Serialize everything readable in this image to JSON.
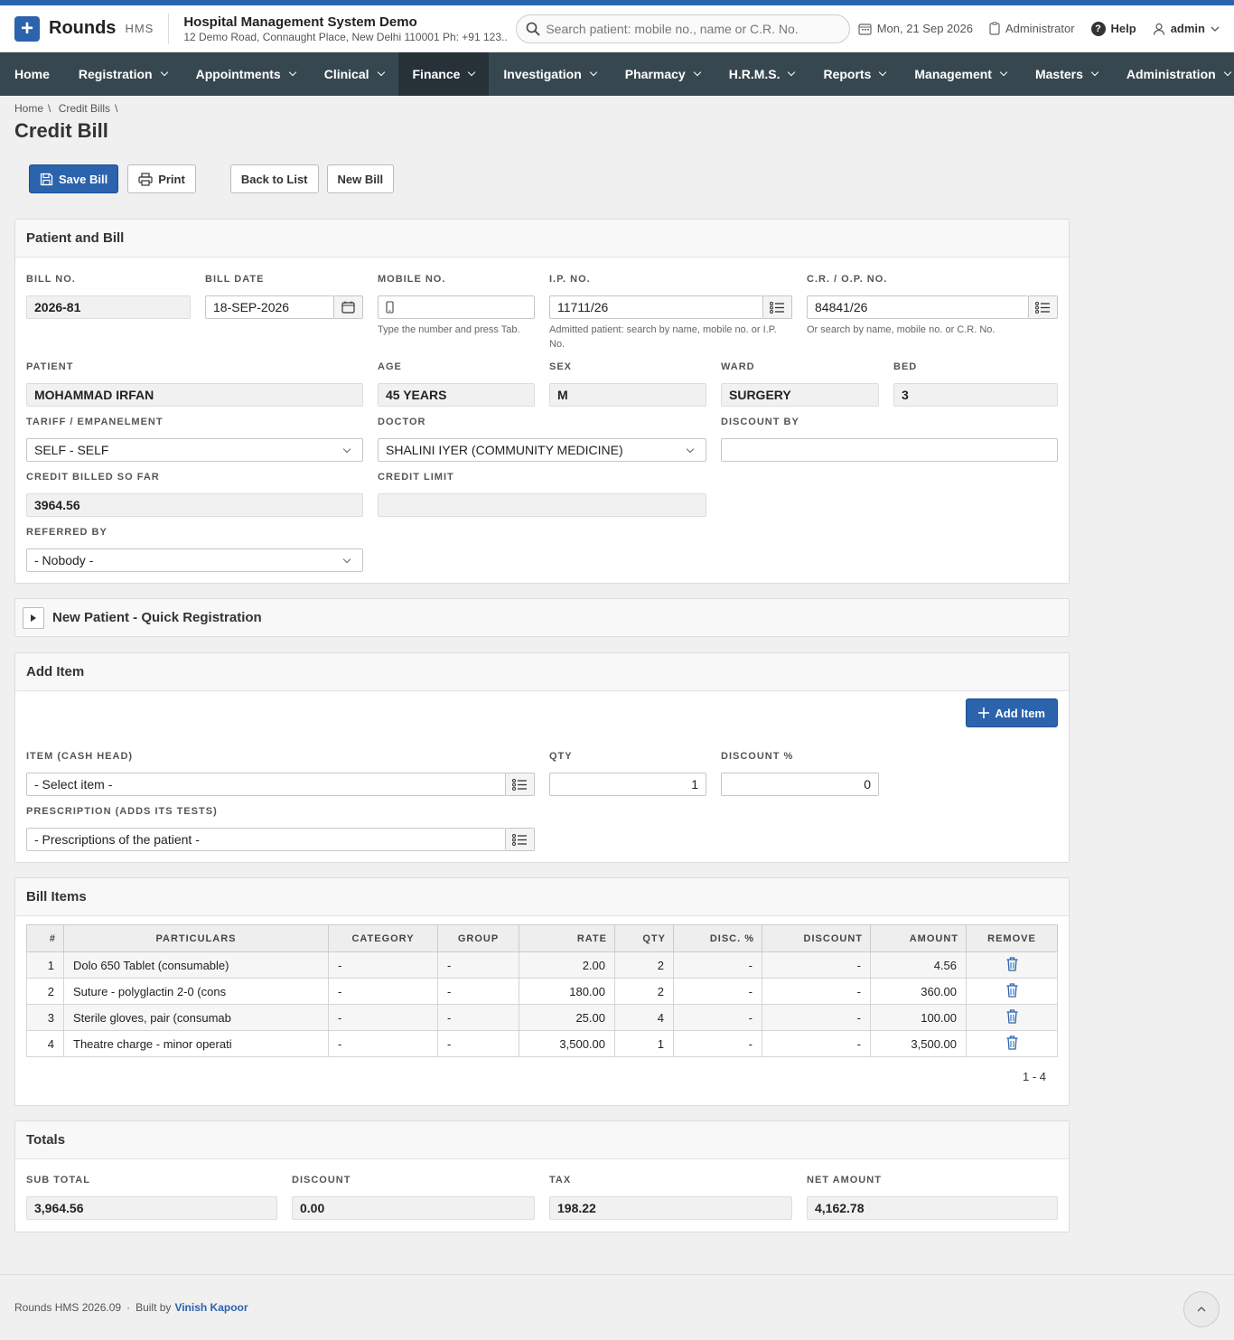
{
  "app": {
    "name": "Rounds",
    "suffix": "HMS",
    "logo_glyph": "+"
  },
  "hospital": {
    "name": "Hospital Management System Demo",
    "address": "12 Demo Road, Connaught Place, New Delhi 110001 Ph: +91 123..."
  },
  "search": {
    "placeholder": "Search patient: mobile no., name or C.R. No."
  },
  "header": {
    "date": "Mon, 21 Sep 2026",
    "role": "Administrator",
    "help": "Help",
    "user": "admin"
  },
  "nav": [
    {
      "label": "Home"
    },
    {
      "label": "Registration"
    },
    {
      "label": "Appointments"
    },
    {
      "label": "Clinical"
    },
    {
      "label": "Finance"
    },
    {
      "label": "Investigation"
    },
    {
      "label": "Pharmacy"
    },
    {
      "label": "H.R.M.S."
    },
    {
      "label": "Reports"
    },
    {
      "label": "Management"
    },
    {
      "label": "Masters"
    },
    {
      "label": "Administration"
    }
  ],
  "breadcrumb": [
    "Home",
    "Credit Bills"
  ],
  "page_title": "Credit Bill",
  "toolbar": {
    "save": "Save Bill",
    "print": "Print",
    "back": "Back to List",
    "new": "New Bill"
  },
  "patient_bill": {
    "heading": "Patient and Bill",
    "bill_no_label": "BILL NO.",
    "bill_no": "2026-81",
    "bill_date_label": "BILL DATE",
    "bill_date": "18-SEP-2026",
    "mobile_label": "MOBILE NO.",
    "mobile": "",
    "mobile_hint": "Type the number and press Tab.",
    "ip_label": "I.P. NO.",
    "ip": "11711/26",
    "ip_hint": "Admitted patient: search by name, mobile no. or I.P. No.",
    "cr_label": "C.R. / O.P. NO.",
    "cr": "84841/26",
    "cr_hint": "Or search by name, mobile no. or C.R. No.",
    "patient_label": "PATIENT",
    "patient": "MOHAMMAD IRFAN",
    "age_label": "AGE",
    "age": "45 YEARS",
    "sex_label": "SEX",
    "sex": "M",
    "ward_label": "WARD",
    "ward": "SURGERY",
    "bed_label": "BED",
    "bed": "3",
    "tariff_label": "TARIFF / EMPANELMENT",
    "tariff": "SELF - SELF",
    "doctor_label": "DOCTOR",
    "doctor": "SHALINI IYER (COMMUNITY MEDICINE)",
    "discount_by_label": "DISCOUNT BY",
    "discount_by": "",
    "credit_billed_label": "CREDIT BILLED SO FAR",
    "credit_billed": "3964.56",
    "credit_limit_label": "CREDIT LIMIT",
    "credit_limit": "",
    "referred_label": "REFERRED BY",
    "referred": "- Nobody -"
  },
  "quick_reg": {
    "heading": "New Patient - Quick Registration"
  },
  "add_item": {
    "heading": "Add Item",
    "add_button": "Add Item",
    "item_label": "ITEM (CASH HEAD)",
    "item": "- Select item -",
    "qty_label": "QTY",
    "qty": "1",
    "disc_label": "DISCOUNT %",
    "disc": "0",
    "rx_label": "PRESCRIPTION (ADDS ITS TESTS)",
    "rx": "- Prescriptions of the patient -"
  },
  "bill_items": {
    "heading": "Bill Items",
    "columns": [
      "#",
      "PARTICULARS",
      "CATEGORY",
      "GROUP",
      "RATE",
      "QTY",
      "DISC. %",
      "DISCOUNT",
      "AMOUNT",
      "REMOVE"
    ],
    "rows": [
      {
        "n": "1",
        "particulars": "Dolo 650 Tablet (consumable)",
        "category": "-",
        "group": "-",
        "rate": "2.00",
        "qty": "2",
        "disc_pct": "-",
        "discount": "-",
        "amount": "4.56"
      },
      {
        "n": "2",
        "particulars": "Suture - polyglactin 2-0 (cons",
        "category": "-",
        "group": "-",
        "rate": "180.00",
        "qty": "2",
        "disc_pct": "-",
        "discount": "-",
        "amount": "360.00"
      },
      {
        "n": "3",
        "particulars": "Sterile gloves, pair (consumab",
        "category": "-",
        "group": "-",
        "rate": "25.00",
        "qty": "4",
        "disc_pct": "-",
        "discount": "-",
        "amount": "100.00"
      },
      {
        "n": "4",
        "particulars": "Theatre charge - minor operati",
        "category": "-",
        "group": "-",
        "rate": "3,500.00",
        "qty": "1",
        "disc_pct": "-",
        "discount": "-",
        "amount": "3,500.00"
      }
    ],
    "pager": "1 - 4"
  },
  "totals": {
    "heading": "Totals",
    "sub_total_label": "SUB TOTAL",
    "sub_total": "3,964.56",
    "discount_label": "DISCOUNT",
    "discount": "0.00",
    "tax_label": "TAX",
    "tax": "198.22",
    "net_label": "NET AMOUNT",
    "net": "4,162.78"
  },
  "footer": {
    "version": "Rounds HMS 2026.09",
    "sep": "·",
    "built_by": "Built by",
    "author": "Vinish Kapoor"
  },
  "colors": {
    "primary": "#2b63ad",
    "nav_bg": "#37474f",
    "nav_active": "#263238"
  }
}
